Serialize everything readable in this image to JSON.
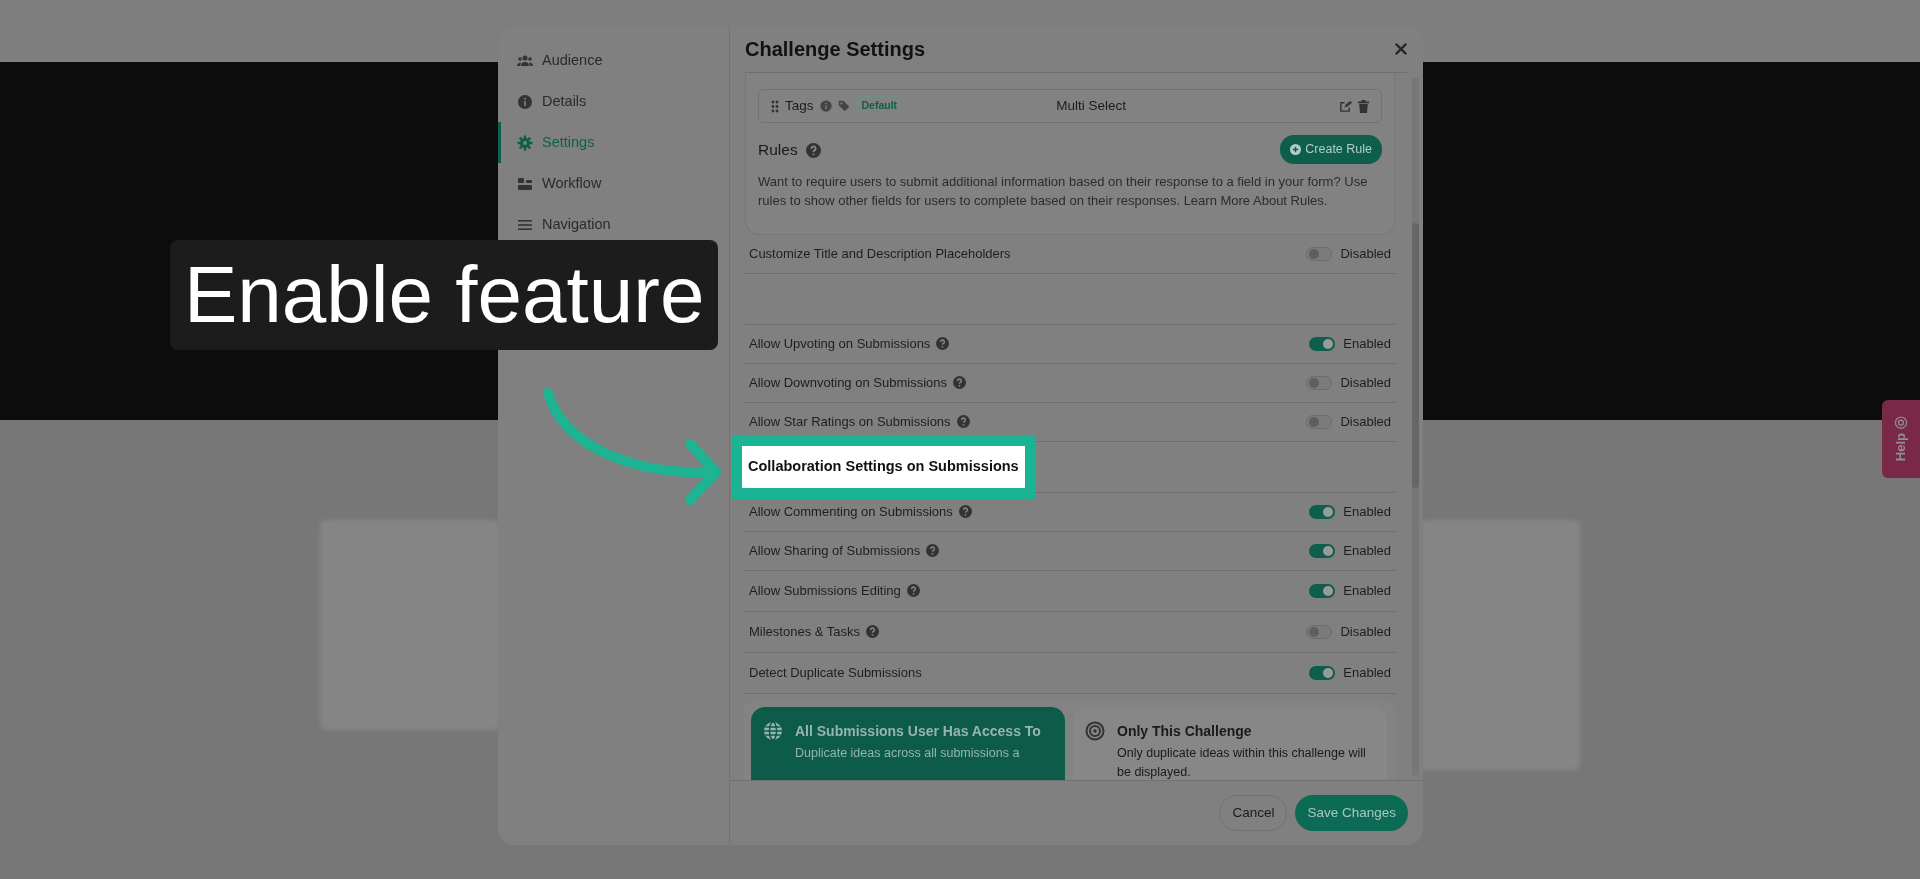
{
  "callout": {
    "text": "Enable feature"
  },
  "sidebar": {
    "items": [
      {
        "label": "Audience",
        "kind": "people",
        "selected": false
      },
      {
        "label": "Details",
        "kind": "info",
        "selected": false
      },
      {
        "label": "Settings",
        "kind": "gear",
        "selected": true
      },
      {
        "label": "Workflow",
        "kind": "workflow",
        "selected": false
      },
      {
        "label": "Navigation",
        "kind": "list",
        "selected": false
      }
    ]
  },
  "modal": {
    "title": "Challenge Settings"
  },
  "tag_field": {
    "label": "Tags",
    "badge": "Default",
    "type": "Multi Select"
  },
  "rules": {
    "title": "Rules",
    "button": "Create Rule",
    "description": "Want to require users to submit additional information based on their response to a field in your form? Use rules to show other fields for users to complete based on their responses.",
    "link": "Learn More About Rules."
  },
  "groups": [
    {
      "rows": [
        {
          "label": "Customize Title and Description Placeholders",
          "help": false,
          "on": false,
          "status": "Disabled"
        }
      ]
    },
    {
      "rows": [
        {
          "label": "Allow Upvoting on Submissions",
          "help": true,
          "on": true,
          "status": "Enabled"
        },
        {
          "label": "Allow Downvoting on Submissions",
          "help": true,
          "on": false,
          "status": "Disabled"
        },
        {
          "label": "Allow Star Ratings on Submissions",
          "help": true,
          "on": false,
          "status": "Disabled"
        }
      ]
    },
    {
      "heading": "Collaboration Settings on Submissions",
      "highlighted": true,
      "rows": [
        {
          "label": "Allow Commenting on Submissions",
          "help": true,
          "on": true,
          "status": "Enabled"
        },
        {
          "label": "Allow Sharing of Submissions",
          "help": true,
          "on": true,
          "status": "Enabled"
        },
        {
          "label": "Allow Submissions Editing",
          "help": true,
          "on": true,
          "status": "Enabled"
        },
        {
          "label": "Milestones & Tasks",
          "help": true,
          "on": false,
          "status": "Disabled"
        },
        {
          "label": "Detect Duplicate Submissions",
          "help": false,
          "on": true,
          "status": "Enabled"
        }
      ]
    }
  ],
  "duplicate_scope": [
    {
      "kind": "globe",
      "title": "All Submissions User Has Access To",
      "description": "Duplicate ideas across all submissions a",
      "selected": true
    },
    {
      "kind": "target",
      "title": "Only This Challenge",
      "description": "Only duplicate ideas within this challenge will be displayed.",
      "selected": false
    }
  ],
  "footer": {
    "buttons": [
      {
        "label": "Cancel",
        "kind": "secondary"
      },
      {
        "label": "Save Changes",
        "kind": "primary"
      }
    ]
  },
  "help_tab": {
    "label": "Help"
  }
}
